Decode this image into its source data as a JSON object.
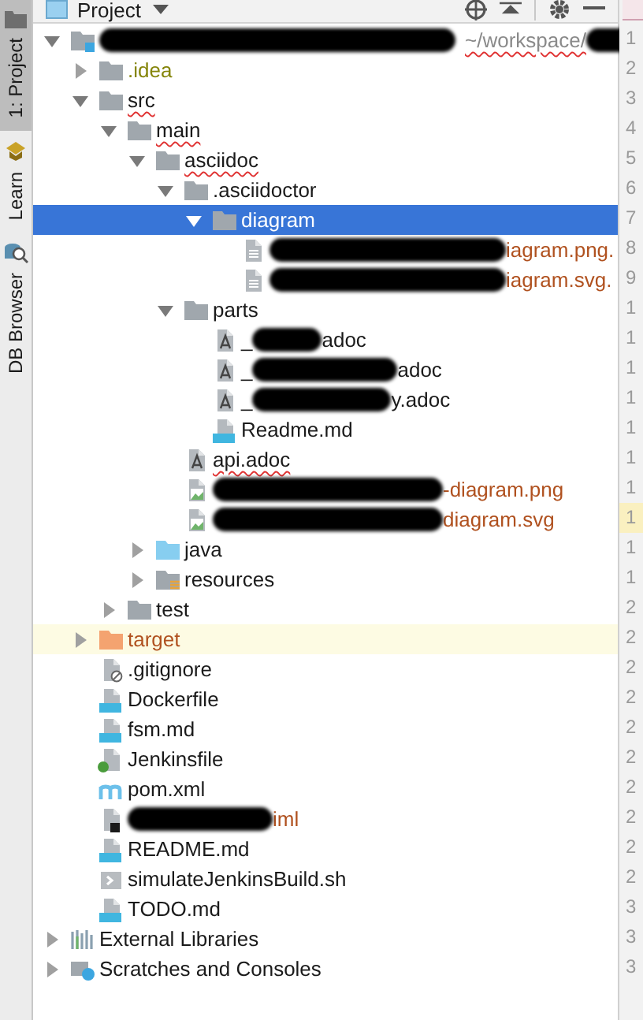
{
  "side_tabs": [
    {
      "kind": "project",
      "label": "1: Project",
      "selected": true
    },
    {
      "kind": "learn",
      "label": "Learn",
      "selected": false
    },
    {
      "kind": "db",
      "label": "DB Browser",
      "selected": false
    }
  ],
  "header": {
    "title": "Project"
  },
  "tree": [
    {
      "kind": "module",
      "segments": [
        {
          "kind": "redacted"
        },
        {
          "kind": "path",
          "text": "~/workspace/"
        },
        {
          "kind": "redacted"
        }
      ],
      "misspelled": true,
      "selected": false,
      "expanded": true,
      "children": [
        {
          "kind": "folder",
          "segments": [
            {
              "kind": "text",
              "text": ".idea"
            }
          ],
          "color": "#85850a",
          "misspelled": false,
          "selected": false,
          "expanded": false
        },
        {
          "kind": "folder",
          "segments": [
            {
              "kind": "text",
              "text": "src"
            }
          ],
          "color": "#1a1a1a",
          "misspelled": true,
          "selected": false,
          "expanded": true,
          "children": [
            {
              "kind": "folder",
              "segments": [
                {
                  "kind": "text",
                  "text": "main"
                }
              ],
              "color": "#1a1a1a",
              "misspelled": true,
              "selected": false,
              "expanded": true,
              "children": [
                {
                  "kind": "folder",
                  "segments": [
                    {
                      "kind": "text",
                      "text": "asciidoc"
                    }
                  ],
                  "color": "#1a1a1a",
                  "misspelled": true,
                  "selected": false,
                  "expanded": true,
                  "children": [
                    {
                      "kind": "folder",
                      "segments": [
                        {
                          "kind": "text",
                          "text": ".asciidoctor"
                        }
                      ],
                      "color": "#1a1a1a",
                      "misspelled": false,
                      "selected": false,
                      "expanded": true,
                      "children": [
                        {
                          "kind": "folder",
                          "segments": [
                            {
                              "kind": "text",
                              "text": "diagram"
                            }
                          ],
                          "misspelled": false,
                          "selected": true,
                          "expanded": true,
                          "children": [
                            {
                              "kind": "text-file",
                              "segments": [
                                {
                                  "kind": "redacted"
                                },
                                {
                                  "kind": "text",
                                  "text": "iagram.png."
                                }
                              ],
                              "color": "#b0511f",
                              "misspelled": false,
                              "selected": false
                            },
                            {
                              "kind": "text-file",
                              "segments": [
                                {
                                  "kind": "redacted"
                                },
                                {
                                  "kind": "text",
                                  "text": "iagram.svg."
                                }
                              ],
                              "color": "#b0511f",
                              "misspelled": false,
                              "selected": false
                            }
                          ]
                        }
                      ]
                    },
                    {
                      "kind": "folder",
                      "segments": [
                        {
                          "kind": "text",
                          "text": "parts"
                        }
                      ],
                      "color": "#1a1a1a",
                      "misspelled": false,
                      "selected": false,
                      "expanded": true,
                      "children": [
                        {
                          "kind": "asciidoc",
                          "segments": [
                            {
                              "kind": "text",
                              "text": "_"
                            },
                            {
                              "kind": "redacted"
                            },
                            {
                              "kind": "text",
                              "text": "adoc"
                            }
                          ],
                          "color": "#1a1a1a",
                          "misspelled": false,
                          "selected": false
                        },
                        {
                          "kind": "asciidoc",
                          "segments": [
                            {
                              "kind": "text",
                              "text": "_"
                            },
                            {
                              "kind": "redacted"
                            },
                            {
                              "kind": "text",
                              "text": "adoc"
                            }
                          ],
                          "color": "#1a1a1a",
                          "misspelled": false,
                          "selected": false
                        },
                        {
                          "kind": "asciidoc",
                          "segments": [
                            {
                              "kind": "text",
                              "text": "_"
                            },
                            {
                              "kind": "redacted"
                            },
                            {
                              "kind": "text",
                              "text": "y.adoc"
                            }
                          ],
                          "color": "#1a1a1a",
                          "misspelled": false,
                          "selected": false
                        },
                        {
                          "kind": "markdown",
                          "segments": [
                            {
                              "kind": "text",
                              "text": "Readme.md"
                            }
                          ],
                          "color": "#1a1a1a",
                          "misspelled": false,
                          "selected": false
                        }
                      ]
                    },
                    {
                      "kind": "asciidoc",
                      "segments": [
                        {
                          "kind": "text",
                          "text": "api.adoc"
                        }
                      ],
                      "color": "#1a1a1a",
                      "misspelled": true,
                      "selected": false
                    },
                    {
                      "kind": "image",
                      "segments": [
                        {
                          "kind": "redacted"
                        },
                        {
                          "kind": "text",
                          "text": "-diagram.png"
                        }
                      ],
                      "color": "#b0511f",
                      "misspelled": false,
                      "selected": false
                    },
                    {
                      "kind": "image",
                      "segments": [
                        {
                          "kind": "redacted"
                        },
                        {
                          "kind": "text",
                          "text": "diagram.svg"
                        }
                      ],
                      "color": "#b0511f",
                      "misspelled": false,
                      "selected": false
                    }
                  ]
                },
                {
                  "kind": "source-folder",
                  "segments": [
                    {
                      "kind": "text",
                      "text": "java"
                    }
                  ],
                  "color": "#1a1a1a",
                  "misspelled": false,
                  "selected": false,
                  "expanded": false
                },
                {
                  "kind": "resources-folder",
                  "segments": [
                    {
                      "kind": "text",
                      "text": "resources"
                    }
                  ],
                  "color": "#1a1a1a",
                  "misspelled": false,
                  "selected": false,
                  "expanded": false
                }
              ]
            },
            {
              "kind": "folder",
              "segments": [
                {
                  "kind": "text",
                  "text": "test"
                }
              ],
              "color": "#1a1a1a",
              "misspelled": false,
              "selected": false,
              "expanded": false
            }
          ]
        },
        {
          "kind": "excluded-folder",
          "segments": [
            {
              "kind": "text",
              "text": "target"
            }
          ],
          "color": "#b0511f",
          "misspelled": false,
          "selected": false,
          "expanded": false
        },
        {
          "kind": "gitignore",
          "segments": [
            {
              "kind": "text",
              "text": ".gitignore"
            }
          ],
          "color": "#1a1a1a",
          "misspelled": false,
          "selected": false
        },
        {
          "kind": "docker",
          "segments": [
            {
              "kind": "text",
              "text": "Dockerfile"
            }
          ],
          "color": "#1a1a1a",
          "misspelled": false,
          "selected": false
        },
        {
          "kind": "markdown",
          "segments": [
            {
              "kind": "text",
              "text": "fsm.md"
            }
          ],
          "color": "#1a1a1a",
          "misspelled": false,
          "selected": false
        },
        {
          "kind": "groovy",
          "segments": [
            {
              "kind": "text",
              "text": "Jenkinsfile"
            }
          ],
          "color": "#1a1a1a",
          "misspelled": false,
          "selected": false
        },
        {
          "kind": "maven",
          "segments": [
            {
              "kind": "text",
              "text": "pom.xml"
            }
          ],
          "color": "#1a1a1a",
          "misspelled": false,
          "selected": false
        },
        {
          "kind": "iml",
          "segments": [
            {
              "kind": "redacted"
            },
            {
              "kind": "text",
              "text": "iml"
            }
          ],
          "color": "#b0511f",
          "misspelled": false,
          "selected": false
        },
        {
          "kind": "markdown",
          "segments": [
            {
              "kind": "text",
              "text": "README.md"
            }
          ],
          "color": "#1a1a1a",
          "misspelled": false,
          "selected": false
        },
        {
          "kind": "shell",
          "segments": [
            {
              "kind": "text",
              "text": "simulateJenkinsBuild.sh"
            }
          ],
          "color": "#1a1a1a",
          "misspelled": false,
          "selected": false
        },
        {
          "kind": "markdown",
          "segments": [
            {
              "kind": "text",
              "text": "TODO.md"
            }
          ],
          "color": "#1a1a1a",
          "misspelled": false,
          "selected": false
        }
      ]
    },
    {
      "kind": "libraries",
      "segments": [
        {
          "kind": "text",
          "text": "External Libraries"
        }
      ],
      "color": "#1a1a1a",
      "misspelled": false,
      "selected": false,
      "expanded": false
    },
    {
      "kind": "scratches",
      "segments": [
        {
          "kind": "text",
          "text": "Scratches and Consoles"
        }
      ],
      "color": "#1a1a1a",
      "misspelled": false,
      "selected": false,
      "expanded": false
    }
  ],
  "gutter": [
    {
      "text": "1",
      "current": false
    },
    {
      "text": "2",
      "current": false
    },
    {
      "text": "3",
      "current": false
    },
    {
      "text": "4",
      "current": false
    },
    {
      "text": "5",
      "current": false
    },
    {
      "text": "6",
      "current": false
    },
    {
      "text": "7",
      "current": false
    },
    {
      "text": "8",
      "current": false
    },
    {
      "text": "9",
      "current": false
    },
    {
      "text": "1",
      "current": false
    },
    {
      "text": "1",
      "current": false
    },
    {
      "text": "1",
      "current": false
    },
    {
      "text": "1",
      "current": false
    },
    {
      "text": "1",
      "current": false
    },
    {
      "text": "1",
      "current": false
    },
    {
      "text": "1",
      "current": false
    },
    {
      "text": "1",
      "current": true
    },
    {
      "text": "1",
      "current": false
    },
    {
      "text": "1",
      "current": false
    },
    {
      "text": "2",
      "current": false
    },
    {
      "text": "2",
      "current": false
    },
    {
      "text": "2",
      "current": false
    },
    {
      "text": "2",
      "current": false
    },
    {
      "text": "2",
      "current": false
    },
    {
      "text": "2",
      "current": false
    },
    {
      "text": "2",
      "current": false
    },
    {
      "text": "2",
      "current": false
    },
    {
      "text": "2",
      "current": false
    },
    {
      "text": "2",
      "current": false
    },
    {
      "text": "3",
      "current": false
    },
    {
      "text": "3",
      "current": false
    },
    {
      "text": "3",
      "current": false
    }
  ]
}
